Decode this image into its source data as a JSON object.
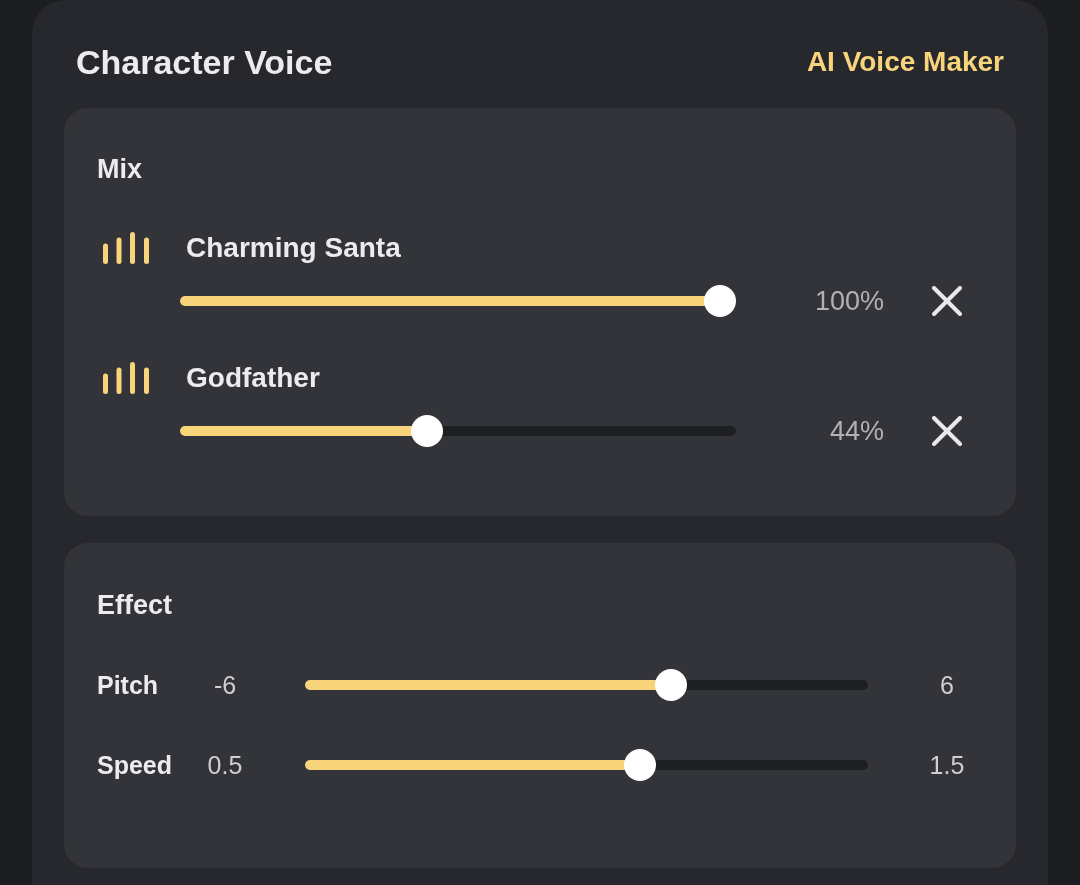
{
  "header": {
    "title": "Character Voice",
    "link": "AI Voice Maker"
  },
  "mix": {
    "title": "Mix",
    "voices": [
      {
        "name": "Charming Santa",
        "level": 1,
        "reading": "100%"
      },
      {
        "name": "Godfather",
        "level": 0.44,
        "reading": "44%"
      }
    ]
  },
  "effect": {
    "title": "Effect",
    "sliders": [
      {
        "label": "Pitch",
        "min": "-6",
        "max": "6",
        "level": 0.66
      },
      {
        "label": "Speed",
        "min": "0.5",
        "max": "1.5",
        "level": 0.6
      }
    ]
  }
}
